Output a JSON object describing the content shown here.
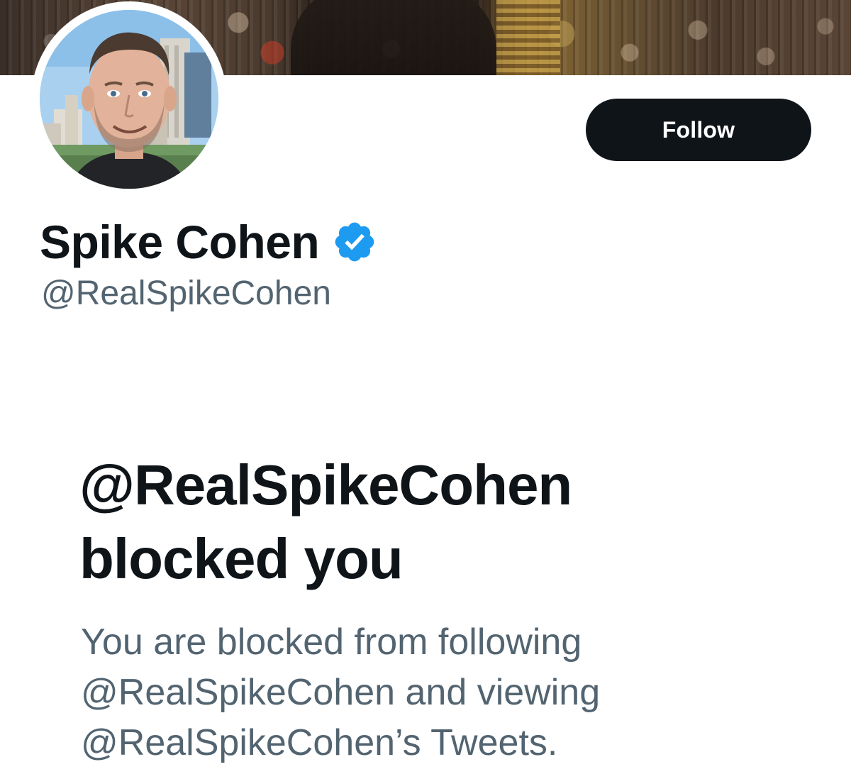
{
  "profile": {
    "display_name": "Spike Cohen",
    "handle": "@RealSpikeCohen",
    "verified": true,
    "verified_color": "#1d9bf0"
  },
  "actions": {
    "follow_label": "Follow"
  },
  "blocked_notice": {
    "title_line1": "@RealSpikeCohen",
    "title_line2": "blocked you",
    "body_line1": "You are blocked from following",
    "body_line2": "@RealSpikeCohen and viewing",
    "body_line3": "@RealSpikeCohen’s Tweets."
  },
  "colors": {
    "primary_text": "#0f1419",
    "secondary_text": "#536471",
    "button_bg": "#0f1419",
    "button_text": "#ffffff"
  },
  "icons": {
    "verified": "verified-badge-icon",
    "avatar": "profile-avatar",
    "banner": "header-banner-image"
  }
}
